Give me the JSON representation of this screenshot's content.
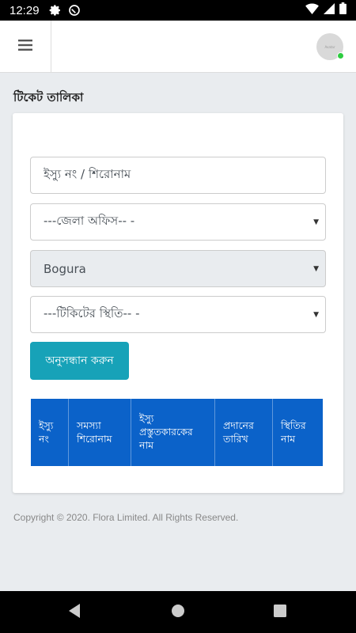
{
  "status_bar": {
    "time": "12:29",
    "icons_left": [
      "settings-icon",
      "no-disturb-icon"
    ],
    "icons_right": [
      "wifi-icon",
      "signal-icon",
      "battery-icon"
    ]
  },
  "header": {
    "menu_icon": "hamburger-icon",
    "avatar_text": "Avatar",
    "avatar_status_color": "#2ecc40"
  },
  "page": {
    "title": "টিকেট তালিকা"
  },
  "form": {
    "issue_input_placeholder": "ইস্যু নং / শিরোনাম",
    "district_office_select": "---জেলা অফিস-- -",
    "location_select": "Bogura",
    "ticket_status_select": "---টিকিটের স্থিতি-- -",
    "search_button": "অনুসন্ধান করুন"
  },
  "table": {
    "headers": [
      "ইস্যু নং",
      "সমস্যা শিরোনাম",
      "ইস্যু প্রস্তুতকারকের নাম",
      "প্রদানের তারিখ",
      "স্থিতির নাম"
    ]
  },
  "footer": {
    "copyright": "Copyright © 2020. Flora Limited. All Rights Reserved."
  },
  "colors": {
    "primary": "#0b62c9",
    "accent": "#17a2b8",
    "background": "#e9ecef"
  },
  "nav": {
    "icons": [
      "back-icon",
      "home-icon",
      "recents-icon"
    ]
  }
}
